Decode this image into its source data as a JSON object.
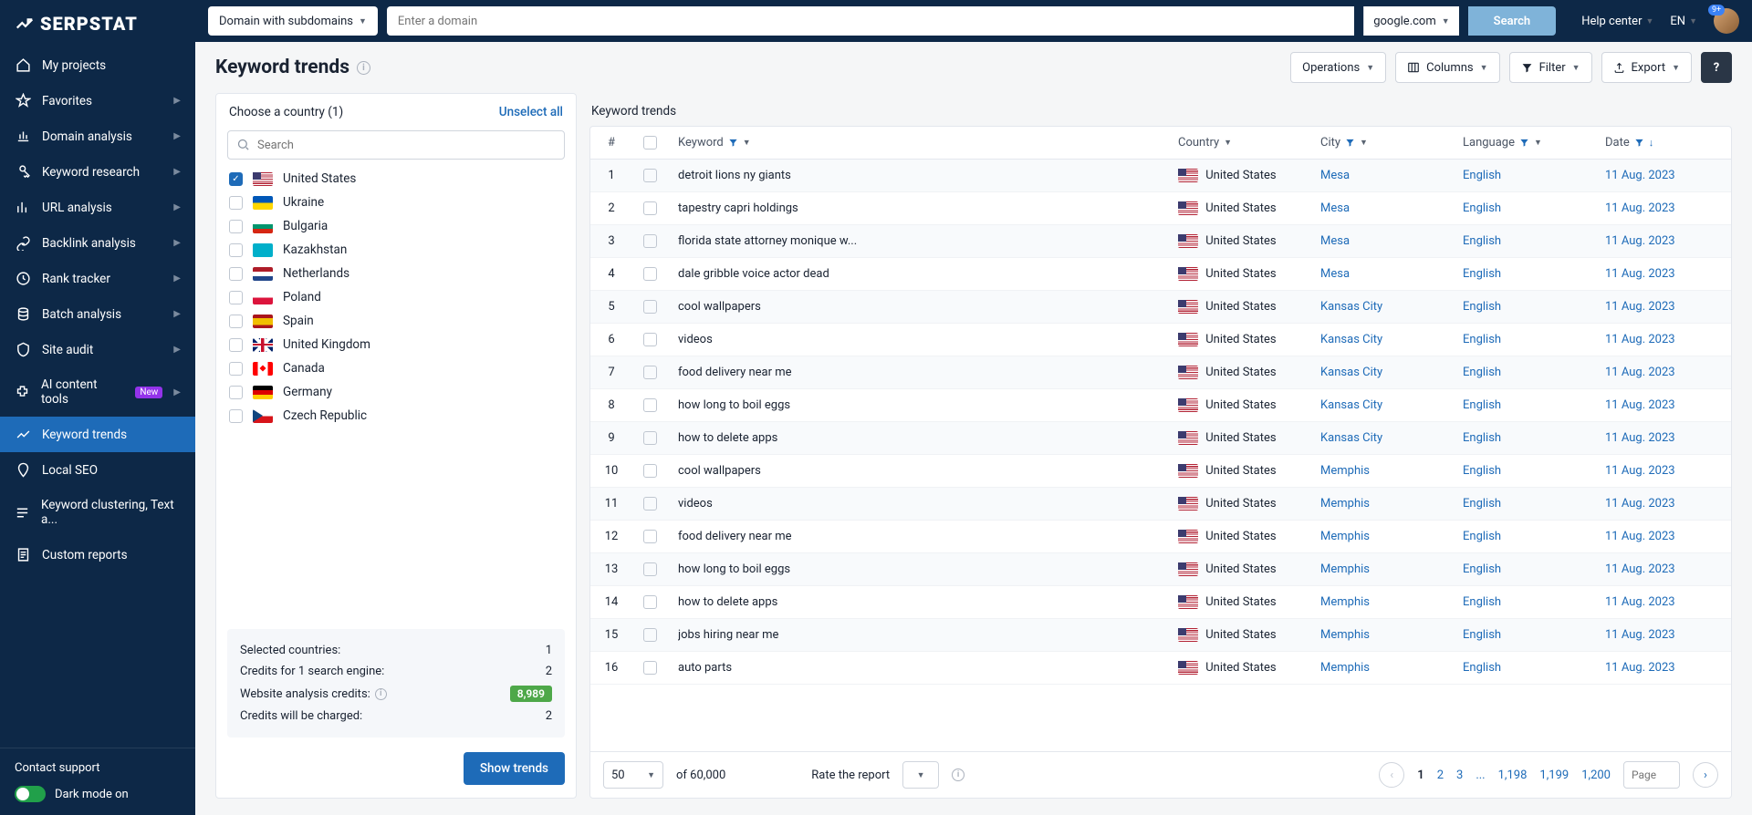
{
  "logo": "SERPSTAT",
  "nav": [
    {
      "icon": "home",
      "label": "My projects",
      "chev": false
    },
    {
      "icon": "pin",
      "label": "Favorites",
      "chev": true
    },
    {
      "icon": "chart",
      "label": "Domain analysis",
      "chev": true
    },
    {
      "icon": "key",
      "label": "Keyword research",
      "chev": true
    },
    {
      "icon": "bars",
      "label": "URL analysis",
      "chev": true
    },
    {
      "icon": "link",
      "label": "Backlink analysis",
      "chev": true
    },
    {
      "icon": "history",
      "label": "Rank tracker",
      "chev": true
    },
    {
      "icon": "db",
      "label": "Batch analysis",
      "chev": true
    },
    {
      "icon": "audit",
      "label": "Site audit",
      "chev": true
    },
    {
      "icon": "ai",
      "label": "AI content tools",
      "chev": true,
      "badge": "New"
    },
    {
      "icon": "trend",
      "label": "Keyword trends",
      "chev": false,
      "active": true
    },
    {
      "icon": "geo",
      "label": "Local SEO",
      "chev": false
    },
    {
      "icon": "cluster",
      "label": "Keyword clustering, Text a...",
      "chev": false
    },
    {
      "icon": "report",
      "label": "Custom reports",
      "chev": false
    }
  ],
  "sidebar_footer": {
    "contact": "Contact support",
    "dark": "Dark mode on"
  },
  "topbar": {
    "domain_select": "Domain with subdomains",
    "search_placeholder": "Enter a domain",
    "engine": "google.com",
    "search": "Search",
    "help": "Help center",
    "lang": "EN",
    "avatar_badge": "9+"
  },
  "page": {
    "title": "Keyword trends"
  },
  "actions": {
    "operations": "Operations",
    "columns": "Columns",
    "filter": "Filter",
    "export": "Export",
    "help": "?"
  },
  "left": {
    "title": "Choose a country (1)",
    "unselect": "Unselect all",
    "search_placeholder": "Search",
    "countries": [
      {
        "name": "United States",
        "flag": "us",
        "checked": true
      },
      {
        "name": "Ukraine",
        "flag": "ua"
      },
      {
        "name": "Bulgaria",
        "flag": "bg"
      },
      {
        "name": "Kazakhstan",
        "flag": "kz"
      },
      {
        "name": "Netherlands",
        "flag": "nl"
      },
      {
        "name": "Poland",
        "flag": "pl"
      },
      {
        "name": "Spain",
        "flag": "es"
      },
      {
        "name": "United Kingdom",
        "flag": "gb"
      },
      {
        "name": "Canada",
        "flag": "ca"
      },
      {
        "name": "Germany",
        "flag": "de"
      },
      {
        "name": "Czech Republic",
        "flag": "cz"
      }
    ],
    "stats": {
      "selected_label": "Selected countries:",
      "selected": "1",
      "credit_se_label": "Credits for 1 search engine:",
      "credit_se": "2",
      "wac_label": "Website analysis credits:",
      "wac": "8,989",
      "charged_label": "Credits will be charged:",
      "charged": "2"
    },
    "show": "Show trends"
  },
  "right": {
    "title": "Keyword trends",
    "cols": {
      "num": "#",
      "kw": "Keyword",
      "ctry": "Country",
      "city": "City",
      "lang": "Language",
      "date": "Date"
    },
    "rows": [
      {
        "n": "1",
        "kw": "detroit lions ny giants",
        "ctry": "United States",
        "city": "Mesa",
        "lang": "English",
        "date": "11 Aug. 2023"
      },
      {
        "n": "2",
        "kw": "tapestry capri holdings",
        "ctry": "United States",
        "city": "Mesa",
        "lang": "English",
        "date": "11 Aug. 2023"
      },
      {
        "n": "3",
        "kw": "florida state attorney monique w...",
        "ctry": "United States",
        "city": "Mesa",
        "lang": "English",
        "date": "11 Aug. 2023"
      },
      {
        "n": "4",
        "kw": "dale gribble voice actor dead",
        "ctry": "United States",
        "city": "Mesa",
        "lang": "English",
        "date": "11 Aug. 2023"
      },
      {
        "n": "5",
        "kw": "cool wallpapers",
        "ctry": "United States",
        "city": "Kansas City",
        "lang": "English",
        "date": "11 Aug. 2023"
      },
      {
        "n": "6",
        "kw": "videos",
        "ctry": "United States",
        "city": "Kansas City",
        "lang": "English",
        "date": "11 Aug. 2023"
      },
      {
        "n": "7",
        "kw": "food delivery near me",
        "ctry": "United States",
        "city": "Kansas City",
        "lang": "English",
        "date": "11 Aug. 2023"
      },
      {
        "n": "8",
        "kw": "how long to boil eggs",
        "ctry": "United States",
        "city": "Kansas City",
        "lang": "English",
        "date": "11 Aug. 2023"
      },
      {
        "n": "9",
        "kw": "how to delete apps",
        "ctry": "United States",
        "city": "Kansas City",
        "lang": "English",
        "date": "11 Aug. 2023"
      },
      {
        "n": "10",
        "kw": "cool wallpapers",
        "ctry": "United States",
        "city": "Memphis",
        "lang": "English",
        "date": "11 Aug. 2023"
      },
      {
        "n": "11",
        "kw": "videos",
        "ctry": "United States",
        "city": "Memphis",
        "lang": "English",
        "date": "11 Aug. 2023"
      },
      {
        "n": "12",
        "kw": "food delivery near me",
        "ctry": "United States",
        "city": "Memphis",
        "lang": "English",
        "date": "11 Aug. 2023"
      },
      {
        "n": "13",
        "kw": "how long to boil eggs",
        "ctry": "United States",
        "city": "Memphis",
        "lang": "English",
        "date": "11 Aug. 2023"
      },
      {
        "n": "14",
        "kw": "how to delete apps",
        "ctry": "United States",
        "city": "Memphis",
        "lang": "English",
        "date": "11 Aug. 2023"
      },
      {
        "n": "15",
        "kw": "jobs hiring near me",
        "ctry": "United States",
        "city": "Memphis",
        "lang": "English",
        "date": "11 Aug. 2023"
      },
      {
        "n": "16",
        "kw": "auto parts",
        "ctry": "United States",
        "city": "Memphis",
        "lang": "English",
        "date": "11 Aug. 2023"
      }
    ],
    "pager": {
      "per": "50",
      "of": "of 60,000",
      "rate": "Rate the report",
      "pages": [
        "1",
        "2",
        "3",
        "...",
        "1,198",
        "1,199",
        "1,200"
      ],
      "page_placeholder": "Page"
    }
  }
}
